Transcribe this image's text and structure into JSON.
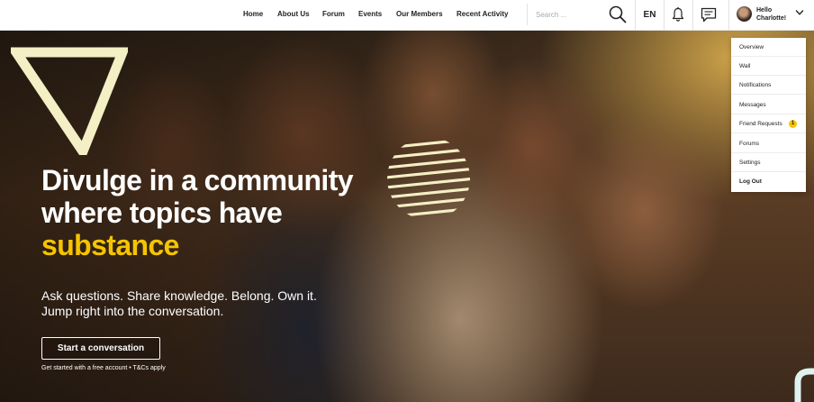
{
  "header": {
    "nav": [
      "Home",
      "About Us",
      "Forum",
      "Events",
      "Our Members",
      "Recent Activity"
    ],
    "search_placeholder": "Search ...",
    "language": "EN",
    "user_greeting_line1": "Hello",
    "user_greeting_line2": "Charlotte!",
    "icons": [
      "search-icon",
      "bell-icon",
      "chat-icon",
      "avatar",
      "chevron-down-icon"
    ]
  },
  "dropdown": {
    "items": [
      "Overview",
      "Wall",
      "Notifications",
      "Messages",
      "Friend Requests",
      "Forums",
      "Settings",
      "Log Out"
    ],
    "friend_requests_badge": "1"
  },
  "hero": {
    "headline_line1": "Divulge in a community",
    "headline_line2": "where topics have",
    "headline_accent": "substance",
    "subcopy_line1": "Ask questions. Share knowledge. Belong. Own it.",
    "subcopy_line2": "Jump right into the conversation.",
    "cta_label": "Start a conversation",
    "fineprint": "Get started with a free account • T&Cs apply"
  },
  "colors": {
    "accent": "#f5c400",
    "header_bg": "#ffffff",
    "text_dark": "#222222",
    "decor_cream": "#f4efc4"
  }
}
